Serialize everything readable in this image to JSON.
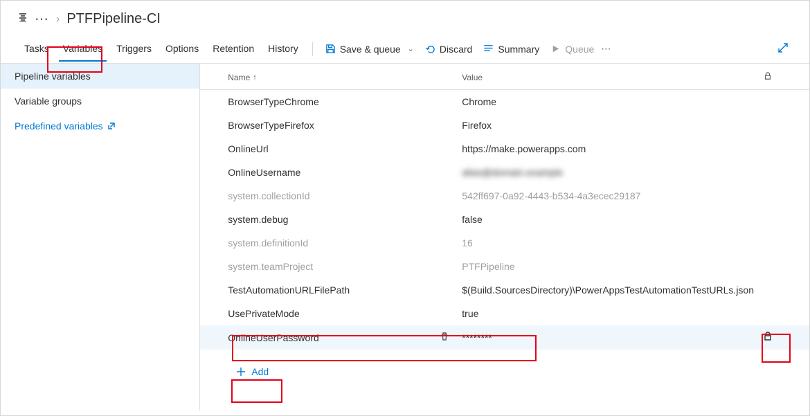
{
  "breadcrumb": {
    "ellipsis": "⋯",
    "title": "PTFPipeline-CI"
  },
  "tabs": {
    "tasks": "Tasks",
    "variables": "Variables",
    "triggers": "Triggers",
    "options": "Options",
    "retention": "Retention",
    "history": "History"
  },
  "actions": {
    "save": "Save & queue",
    "discard": "Discard",
    "summary": "Summary",
    "queue": "Queue"
  },
  "sidebar": {
    "pipeline_vars": "Pipeline variables",
    "var_groups": "Variable groups",
    "predefined": "Predefined variables"
  },
  "headers": {
    "name": "Name",
    "value": "Value"
  },
  "rows": [
    {
      "name": "BrowserTypeChrome",
      "value": "Chrome",
      "sys": false
    },
    {
      "name": "BrowserTypeFirefox",
      "value": "Firefox",
      "sys": false
    },
    {
      "name": "OnlineUrl",
      "value": "https://make.powerapps.com",
      "sys": false
    },
    {
      "name": "OnlineUsername",
      "value": "alias@domain.example",
      "sys": false,
      "blur": true
    },
    {
      "name": "system.collectionId",
      "value": "542ff697-0a92-4443-b534-4a3ecec29187",
      "sys": true
    },
    {
      "name": "system.debug",
      "value": "false",
      "sys": false
    },
    {
      "name": "system.definitionId",
      "value": "16",
      "sys": true
    },
    {
      "name": "system.teamProject",
      "value": "PTFPipeline",
      "sys": true
    },
    {
      "name": "TestAutomationURLFilePath",
      "value": "$(Build.SourcesDirectory)\\PowerAppsTestAutomationTestURLs.json",
      "sys": false
    },
    {
      "name": "UsePrivateMode",
      "value": "true",
      "sys": false
    },
    {
      "name": "OnlineUserPassword",
      "value": "********",
      "sys": false,
      "selected": true,
      "lock": true
    }
  ],
  "add_label": "Add"
}
